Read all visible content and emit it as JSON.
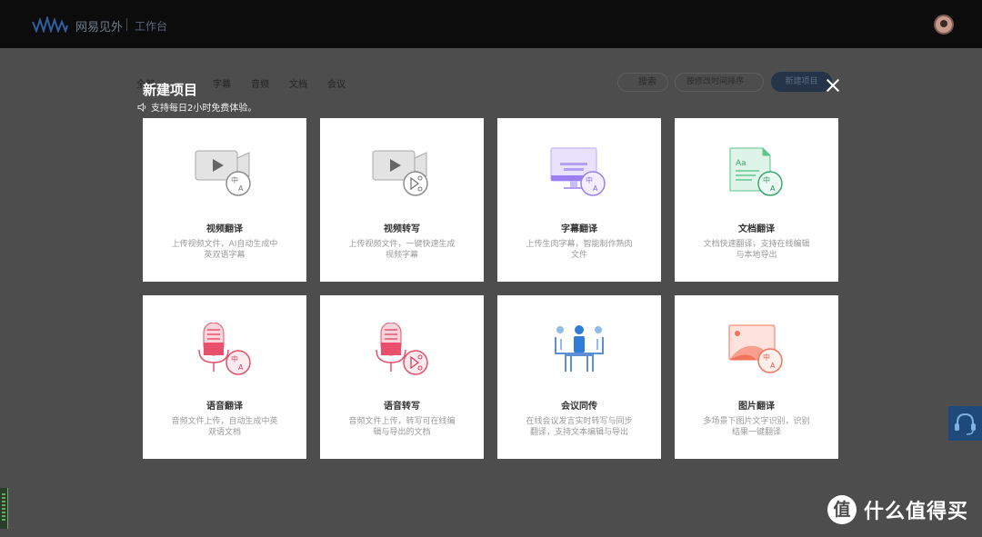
{
  "header": {
    "brand": "网易见外",
    "workspace": "工作台"
  },
  "background": {
    "tabs": [
      "全部",
      "字幕",
      "音频",
      "文档",
      "会议"
    ],
    "search_label": "搜索",
    "sort_label": "按修改时间排序",
    "new_project_label": "新建项目"
  },
  "modal": {
    "title": "新建项目",
    "notice": "支持每日2小时免费体验。",
    "cards": [
      {
        "title": "视频翻译",
        "desc": "上传视频文件，AI自动生成中英双语字幕",
        "icon": "video-translate-icon"
      },
      {
        "title": "视频转写",
        "desc": "上传视频文件，一键快速生成视频字幕",
        "icon": "video-transcribe-icon"
      },
      {
        "title": "字幕翻译",
        "desc": "上传生肉字幕，智能制作熟肉文件",
        "icon": "subtitle-translate-icon"
      },
      {
        "title": "文档翻译",
        "desc": "文档快速翻译，支持在线编辑与本地导出",
        "icon": "document-translate-icon"
      },
      {
        "title": "语音翻译",
        "desc": "音频文件上传，自动生成中英双语文档",
        "icon": "audio-translate-icon"
      },
      {
        "title": "语音转写",
        "desc": "音频文件上传，转写可在线编辑与导出的文档",
        "icon": "audio-transcribe-icon"
      },
      {
        "title": "会议同传",
        "desc": "在线会议发言实时转写与同步翻译，支持文本编辑与导出",
        "icon": "meeting-interpret-icon"
      },
      {
        "title": "图片翻译",
        "desc": "多场景下图片文字识别，识别结果一键翻译",
        "icon": "image-translate-icon"
      }
    ]
  },
  "watermark": {
    "badge": "值",
    "text": "什么值得买"
  },
  "colors": {
    "topbar": "#0c0c0c",
    "overlay": "#4d4d4d",
    "accent_blue": "#5b8fd6",
    "accent_purple": "#9b7ff0",
    "accent_green": "#5ec48d",
    "accent_red": "#e8506b",
    "accent_orange": "#f2745a"
  }
}
